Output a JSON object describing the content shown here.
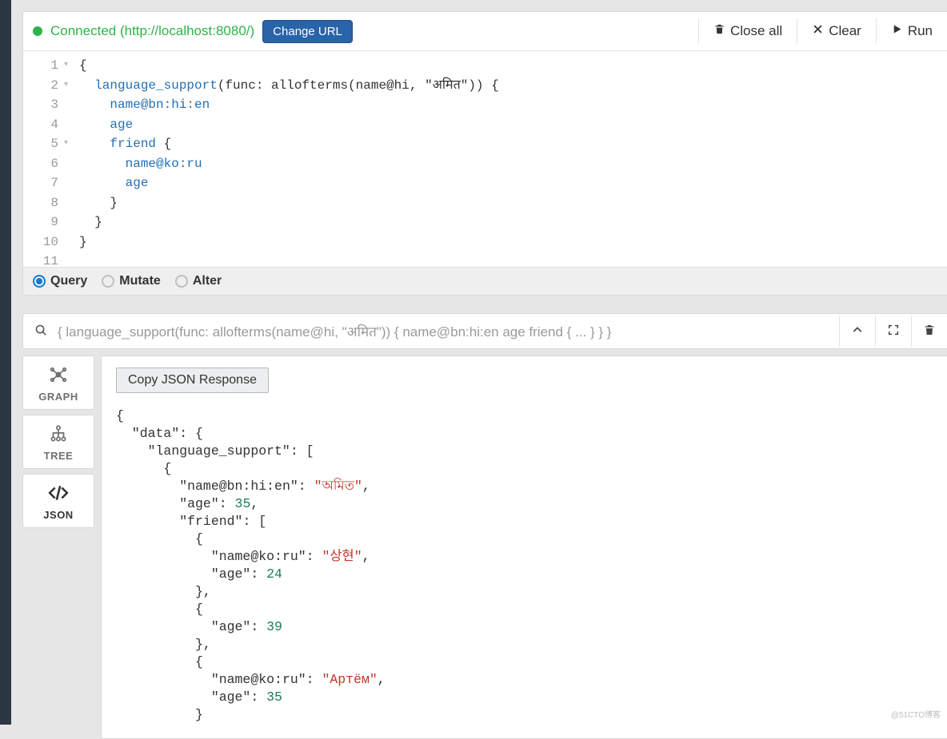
{
  "header": {
    "status_text": "Connected (http://localhost:8080/)",
    "change_url_btn": "Change URL",
    "close_all_btn": "Close all",
    "clear_btn": "Clear",
    "run_btn": "Run"
  },
  "editor": {
    "line_numbers": [
      "1",
      "2",
      "3",
      "4",
      "5",
      "6",
      "7",
      "8",
      "9",
      "10",
      "11"
    ],
    "lines": [
      {
        "indent": 0,
        "segments": [
          {
            "cls": "tok-brace",
            "text": "{"
          }
        ]
      },
      {
        "indent": 1,
        "segments": [
          {
            "cls": "tok-kw",
            "text": "language_support"
          },
          {
            "cls": "",
            "text": "(func: allofterms(name@hi, \"अमित\")) "
          },
          {
            "cls": "tok-brace",
            "text": "{"
          }
        ]
      },
      {
        "indent": 2,
        "segments": [
          {
            "cls": "tok-field",
            "text": "name@bn:hi:en"
          }
        ]
      },
      {
        "indent": 2,
        "segments": [
          {
            "cls": "tok-field",
            "text": "age"
          }
        ]
      },
      {
        "indent": 2,
        "segments": [
          {
            "cls": "tok-field",
            "text": "friend "
          },
          {
            "cls": "tok-brace",
            "text": "{"
          }
        ]
      },
      {
        "indent": 3,
        "segments": [
          {
            "cls": "tok-field",
            "text": "name@ko:ru"
          }
        ]
      },
      {
        "indent": 3,
        "segments": [
          {
            "cls": "tok-field",
            "text": "age"
          }
        ]
      },
      {
        "indent": 2,
        "segments": [
          {
            "cls": "tok-brace",
            "text": "}"
          }
        ]
      },
      {
        "indent": 1,
        "segments": [
          {
            "cls": "tok-brace",
            "text": "}"
          }
        ]
      },
      {
        "indent": 0,
        "segments": [
          {
            "cls": "tok-brace",
            "text": "}"
          }
        ]
      },
      {
        "indent": 0,
        "segments": [
          {
            "cls": "",
            "text": ""
          }
        ]
      }
    ]
  },
  "modes": {
    "query": "Query",
    "mutate": "Mutate",
    "alter": "Alter"
  },
  "summary_text": "{ language_support(func: allofterms(name@hi, \"अमित\")) { name@bn:hi:en age friend { ... } } }",
  "sidetabs": {
    "graph": "GRAPH",
    "tree": "TREE",
    "json": "JSON"
  },
  "copy_btn": "Copy JSON Response",
  "json_tokens": [
    {
      "i": 0,
      "t": "{",
      "c": "jpunct"
    },
    {
      "i": 1,
      "t": "\"data\"",
      "c": "jkey"
    },
    {
      "t": ": {",
      "c": "jpunct"
    },
    {
      "i": 2,
      "t": "\"language_support\"",
      "c": "jkey"
    },
    {
      "t": ": [",
      "c": "jpunct"
    },
    {
      "i": 3,
      "t": "{",
      "c": "jpunct"
    },
    {
      "i": 4,
      "t": "\"name@bn:hi:en\"",
      "c": "jkey"
    },
    {
      "t": ": ",
      "c": "jpunct"
    },
    {
      "t": "\"অমিত\"",
      "c": "jstr"
    },
    {
      "t": ",",
      "c": "jpunct"
    },
    {
      "i": 4,
      "t": "\"age\"",
      "c": "jkey"
    },
    {
      "t": ": ",
      "c": "jpunct"
    },
    {
      "t": "35",
      "c": "jnum"
    },
    {
      "t": ",",
      "c": "jpunct"
    },
    {
      "i": 4,
      "t": "\"friend\"",
      "c": "jkey"
    },
    {
      "t": ": [",
      "c": "jpunct"
    },
    {
      "i": 5,
      "t": "{",
      "c": "jpunct"
    },
    {
      "i": 6,
      "t": "\"name@ko:ru\"",
      "c": "jkey"
    },
    {
      "t": ": ",
      "c": "jpunct"
    },
    {
      "t": "\"상현\"",
      "c": "jstr"
    },
    {
      "t": ",",
      "c": "jpunct"
    },
    {
      "i": 6,
      "t": "\"age\"",
      "c": "jkey"
    },
    {
      "t": ": ",
      "c": "jpunct"
    },
    {
      "t": "24",
      "c": "jnum"
    },
    {
      "i": 5,
      "t": "},",
      "c": "jpunct"
    },
    {
      "i": 5,
      "t": "{",
      "c": "jpunct"
    },
    {
      "i": 6,
      "t": "\"age\"",
      "c": "jkey"
    },
    {
      "t": ": ",
      "c": "jpunct"
    },
    {
      "t": "39",
      "c": "jnum"
    },
    {
      "i": 5,
      "t": "},",
      "c": "jpunct"
    },
    {
      "i": 5,
      "t": "{",
      "c": "jpunct"
    },
    {
      "i": 6,
      "t": "\"name@ko:ru\"",
      "c": "jkey"
    },
    {
      "t": ": ",
      "c": "jpunct"
    },
    {
      "t": "\"Артём\"",
      "c": "jstr"
    },
    {
      "t": ",",
      "c": "jpunct"
    },
    {
      "i": 6,
      "t": "\"age\"",
      "c": "jkey"
    },
    {
      "t": ": ",
      "c": "jpunct"
    },
    {
      "t": "35",
      "c": "jnum"
    },
    {
      "i": 5,
      "t": "}",
      "c": "jpunct"
    }
  ],
  "watermark": "@51CTO博客"
}
